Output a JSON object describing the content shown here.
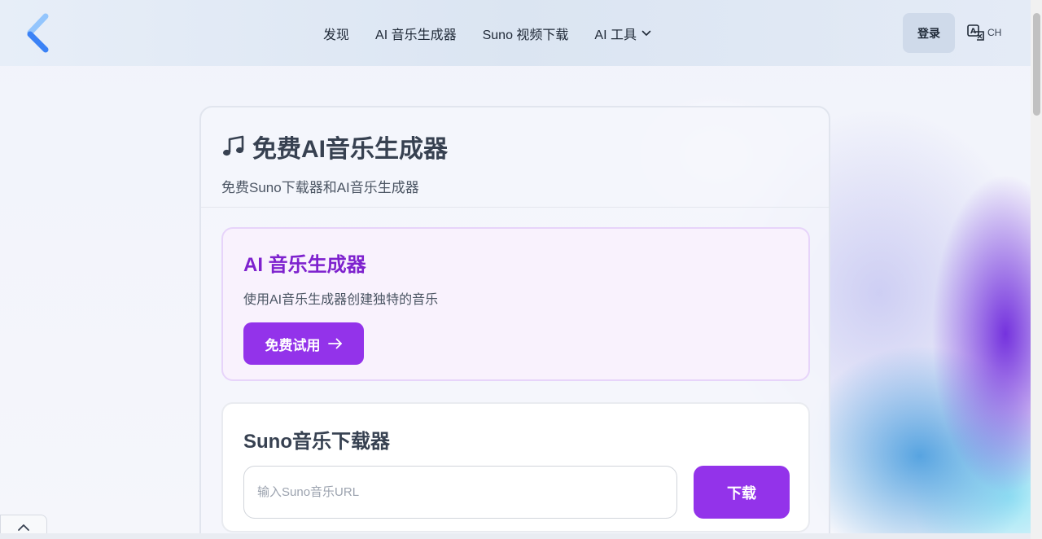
{
  "header": {
    "nav": [
      {
        "label": "发现"
      },
      {
        "label": "AI 音乐生成器"
      },
      {
        "label": "Suno 视频下载"
      },
      {
        "label": "AI 工具"
      }
    ],
    "login_label": "登录",
    "lang_label": "CH"
  },
  "main": {
    "title": "免费AI音乐生成器",
    "subtitle": "免费Suno下载器和AI音乐生成器",
    "generator": {
      "title": "AI 音乐生成器",
      "description": "使用AI音乐生成器创建独特的音乐",
      "button_label": "免费试用"
    },
    "downloader": {
      "title": "Suno音乐下载器",
      "input_placeholder": "输入Suno音乐URL",
      "input_value": "",
      "button_label": "下载"
    }
  },
  "colors": {
    "accent": "#9333ea",
    "accent_text": "#7e22ce",
    "logo_blue": "#3b82f6"
  },
  "icons": [
    "logo-chevron",
    "chevron-down-icon",
    "translate-icon",
    "music-note-icon",
    "arrow-right-icon",
    "chevron-up-icon"
  ]
}
